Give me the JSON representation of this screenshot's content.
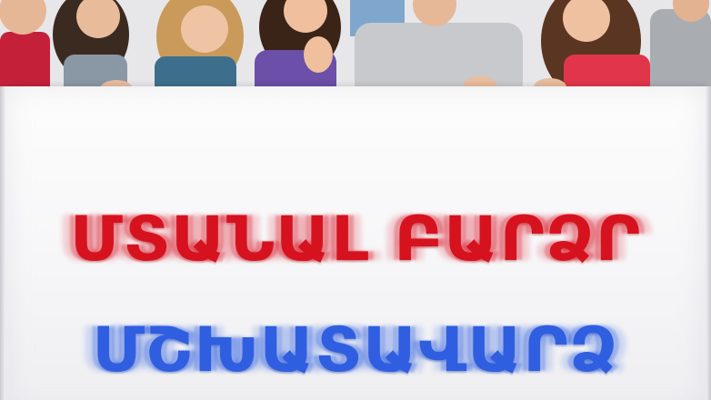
{
  "banner": {
    "line1": "ՄՏԱՆԱԼ ԲԱՐՁՐ",
    "line2": "ՄՇԽԱՏԱՎԱՐՁ"
  },
  "colors": {
    "line1": "#d6121f",
    "line2": "#2f5fe0",
    "board": "#f6f6f8"
  }
}
